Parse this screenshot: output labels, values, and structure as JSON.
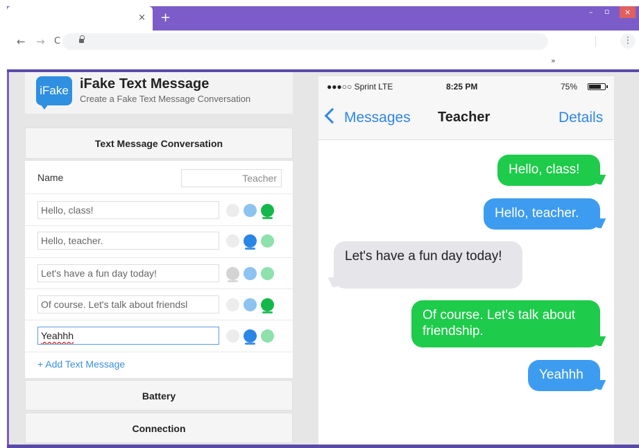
{
  "browser": {
    "tab_close": "×",
    "new_tab": "+",
    "win_min": "–",
    "win_max": "▫",
    "win_close": "×",
    "back": "←",
    "forward": "→",
    "reload": "C",
    "menu": "⋮",
    "bookmarks_overflow": "»"
  },
  "app": {
    "logo_text": "iFake",
    "title": "iFake Text Message",
    "subtitle": "Create a Fake Text Message Conversation"
  },
  "editor": {
    "section_title": "Text Message Conversation",
    "name_label": "Name",
    "name_value": "Teacher",
    "messages": [
      {
        "text": "Hello, class!",
        "type": "green"
      },
      {
        "text": "Hello, teacher.",
        "type": "blue"
      },
      {
        "text": "Let's have a fun day today!",
        "type": "gray"
      },
      {
        "text": "Of course. Let's talk about friendsl",
        "type": "green"
      },
      {
        "text": "Yeahhh",
        "type": "blue"
      }
    ],
    "add_message": "+ Add Text Message",
    "battery_title": "Battery",
    "connection_title": "Connection"
  },
  "phone": {
    "carrier": "●●●○○ Sprint  LTE",
    "time": "8:25 PM",
    "battery": "75%",
    "back_label": "Messages",
    "contact": "Teacher",
    "details": "Details",
    "bubbles": [
      {
        "text": "Hello, class!",
        "type": "green"
      },
      {
        "text": "Hello, teacher.",
        "type": "blue"
      },
      {
        "text": "Let's have a fun day today!",
        "type": "gray"
      },
      {
        "text": "Of course. Let's talk about friendship.",
        "type": "green"
      },
      {
        "text": "Yeahhh",
        "type": "blue"
      }
    ]
  },
  "colors": {
    "browser_accent": "#7b5cc8",
    "imessage_green": "#1ecb4a",
    "imessage_blue": "#3d9cf0",
    "received_gray": "#e5e5ea",
    "ios_link": "#2e86e8"
  }
}
